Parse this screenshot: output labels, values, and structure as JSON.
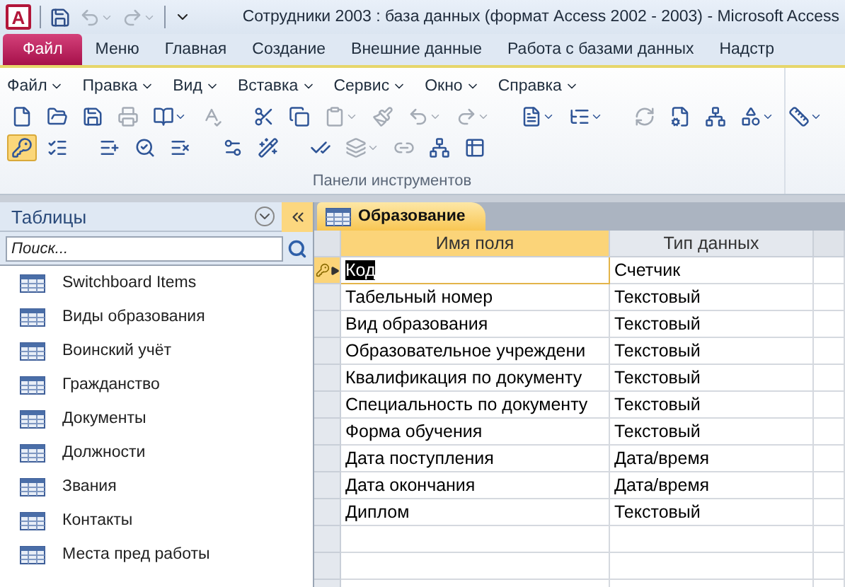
{
  "window": {
    "logo": "A",
    "title": "Сотрудники 2003 : база данных (формат Access 2002 - 2003)  -  Microsoft Access"
  },
  "ribbon_tabs": [
    {
      "label": "Файл",
      "selected": true
    },
    {
      "label": "Меню",
      "selected": false
    },
    {
      "label": "Главная",
      "selected": false
    },
    {
      "label": "Создание",
      "selected": false
    },
    {
      "label": "Внешние данные",
      "selected": false
    },
    {
      "label": "Работа с базами данных",
      "selected": false
    },
    {
      "label": "Надстр",
      "selected": false
    }
  ],
  "menu": [
    "Файл",
    "Правка",
    "Вид",
    "Вставка",
    "Сервис",
    "Окно",
    "Справка"
  ],
  "toolbar_rows": [
    [
      {
        "disabled": false,
        "dropdown": false
      },
      {
        "disabled": false,
        "dropdown": false
      },
      {
        "disabled": false,
        "dropdown": false
      },
      {
        "disabled": true,
        "dropdown": false
      },
      {
        "disabled": false,
        "dropdown": true
      },
      {
        "disabled": true,
        "dropdown": false
      },
      {
        "disabled": false,
        "dropdown": false
      },
      {
        "disabled": false,
        "dropdown": false
      },
      {
        "disabled": true,
        "dropdown": true
      },
      {
        "disabled": true,
        "dropdown": false
      },
      {
        "disabled": true,
        "dropdown": true
      },
      {
        "disabled": true,
        "dropdown": true
      },
      {
        "disabled": false,
        "dropdown": true
      },
      {
        "disabled": false,
        "dropdown": true
      },
      {
        "disabled": true,
        "dropdown": false
      },
      {
        "disabled": false,
        "dropdown": false
      },
      {
        "disabled": false,
        "dropdown": false
      },
      {
        "disabled": false,
        "dropdown": true
      },
      {
        "disabled": false,
        "dropdown": true
      }
    ],
    [
      {
        "selected": true,
        "disabled": false,
        "dropdown": false
      },
      {
        "selected": false,
        "disabled": false,
        "dropdown": false
      },
      {
        "selected": false,
        "disabled": false,
        "dropdown": false
      },
      {
        "selected": false,
        "disabled": false,
        "dropdown": false
      },
      {
        "selected": false,
        "disabled": false,
        "dropdown": false
      },
      {
        "selected": false,
        "disabled": false,
        "dropdown": false
      },
      {
        "selected": false,
        "disabled": false,
        "dropdown": false
      },
      {
        "selected": false,
        "disabled": false,
        "dropdown": false
      },
      {
        "selected": false,
        "disabled": true,
        "dropdown": true
      },
      {
        "selected": false,
        "disabled": true,
        "dropdown": false
      },
      {
        "selected": false,
        "disabled": false,
        "dropdown": false
      },
      {
        "selected": false,
        "disabled": false,
        "dropdown": false
      }
    ]
  ],
  "ribbon_group_label": "Панели инструментов",
  "sidebar": {
    "title": "Таблицы",
    "search": {
      "placeholder": "Поиск..."
    },
    "items": [
      "Switchboard Items",
      "Виды образования",
      "Воинский учёт",
      "Гражданство",
      "Документы",
      "Должности",
      "Звания",
      "Контакты",
      "Места пред работы"
    ]
  },
  "document_tab": {
    "label": "Образование"
  },
  "table": {
    "columns": [
      {
        "label": "Имя поля",
        "selected": true
      },
      {
        "label": "Тип данных",
        "selected": false
      }
    ],
    "rows": [
      {
        "field": "Код",
        "type": "Счетчик",
        "primary_key": true,
        "current": true
      },
      {
        "field": "Табельный номер",
        "type": "Текстовый",
        "primary_key": false,
        "current": false
      },
      {
        "field": "Вид образования",
        "type": "Текстовый",
        "primary_key": false,
        "current": false
      },
      {
        "field": "Образовательное учреждени",
        "type": "Текстовый",
        "primary_key": false,
        "current": false
      },
      {
        "field": "Квалификация по документу",
        "type": "Текстовый",
        "primary_key": false,
        "current": false
      },
      {
        "field": "Специальность по документу",
        "type": "Текстовый",
        "primary_key": false,
        "current": false
      },
      {
        "field": "Форма обучения",
        "type": "Текстовый",
        "primary_key": false,
        "current": false
      },
      {
        "field": "Дата поступления",
        "type": "Дата/время",
        "primary_key": false,
        "current": false
      },
      {
        "field": "Дата окончания",
        "type": "Дата/время",
        "primary_key": false,
        "current": false
      },
      {
        "field": "Диплом",
        "type": "Текстовый",
        "primary_key": false,
        "current": false
      }
    ]
  }
}
